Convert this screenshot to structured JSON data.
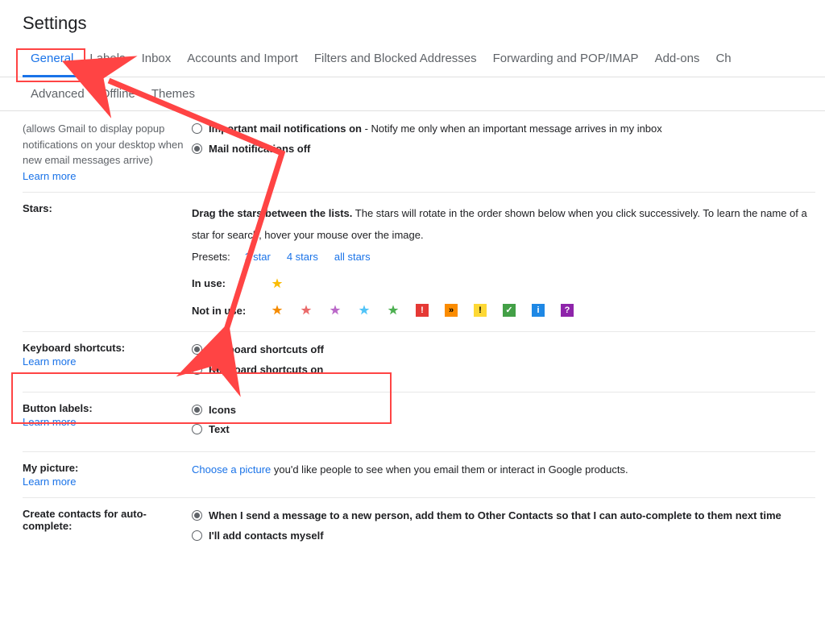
{
  "title": "Settings",
  "tabs_row1": [
    "General",
    "Labels",
    "Inbox",
    "Accounts and Import",
    "Filters and Blocked Addresses",
    "Forwarding and POP/IMAP",
    "Add-ons",
    "Ch"
  ],
  "tabs_row2": [
    "Advanced",
    "Offline",
    "Themes"
  ],
  "notifications": {
    "desc": "(allows Gmail to display popup notifications on your desktop when new email messages arrive)",
    "learn_more": "Learn more",
    "opt1_label": "Important mail notifications on",
    "opt1_desc": " - Notify me only when an important message arrives in my inbox",
    "opt2_label": "Mail notifications off"
  },
  "stars": {
    "label": "Stars:",
    "drag_label": "Drag the stars between the lists.",
    "drag_desc": "  The stars will rotate in the order shown below when you click successively. To learn the name of a star for search, hover your mouse over the image.",
    "presets": "Presets:",
    "preset_links": [
      "1 star",
      "4 stars",
      "all stars"
    ],
    "in_use": "In use:",
    "not_in_use": "Not in use:"
  },
  "keyboard": {
    "label": "Keyboard shortcuts:",
    "learn_more": "Learn more",
    "opt1": "Keyboard shortcuts off",
    "opt2": "Keyboard shortcuts on"
  },
  "button_labels": {
    "label": "Button labels:",
    "learn_more": "Learn more",
    "opt1": "Icons",
    "opt2": "Text"
  },
  "picture": {
    "label": "My picture:",
    "learn_more": "Learn more",
    "link": "Choose a picture",
    "desc": " you'd like people to see when you email them or interact in Google products."
  },
  "contacts": {
    "label": "Create contacts for auto-complete:",
    "opt1": "When I send a message to a new person, add them to Other Contacts so that I can auto-complete to them next time",
    "opt2": "I'll add contacts myself"
  }
}
